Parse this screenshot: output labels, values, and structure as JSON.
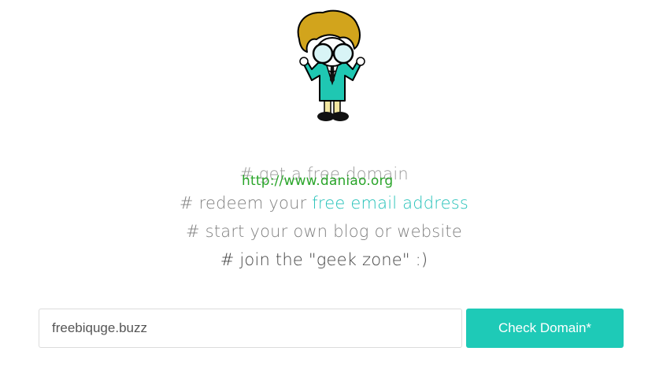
{
  "mascot": {
    "icon": "geek-mascot-icon"
  },
  "taglines": {
    "line1": "# get a free domain",
    "line2_prefix": "# redeem your ",
    "line2_link": "free email address",
    "line3": "# start your own blog or website",
    "line4": "# join the \"geek zone\" :)"
  },
  "watermark": "http://www.daniao.org",
  "search": {
    "value": "freebiquge.buzz",
    "button_label": "Check Domain*"
  },
  "colors": {
    "accent": "#1ecab7",
    "link": "#26c2b9",
    "watermark": "#2aa52a"
  }
}
